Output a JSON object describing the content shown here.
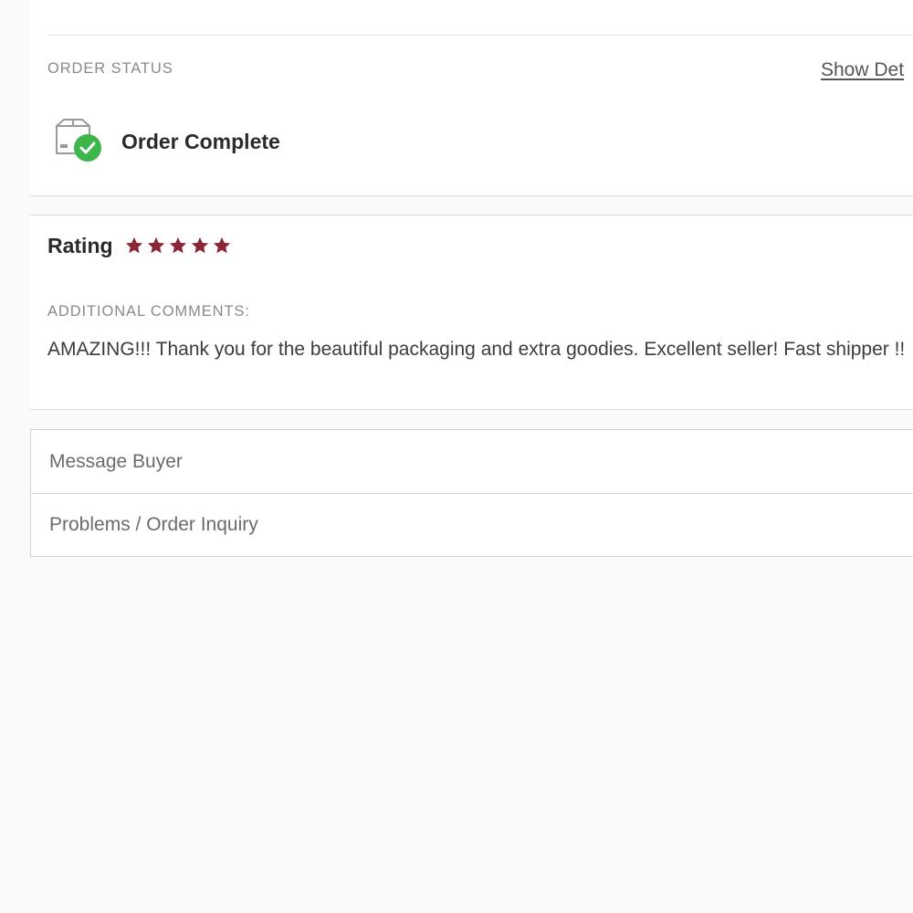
{
  "order_status": {
    "section_label": "ORDER STATUS",
    "show_details_label": "Show Det",
    "status_icon": "box-check-icon",
    "status_text": "Order Complete",
    "status_color": "#3cb64a"
  },
  "rating": {
    "title": "Rating",
    "stars_filled": 5,
    "stars_total": 5,
    "star_color": "#8b2535",
    "comments_label": "ADDITIONAL COMMENTS:",
    "comment_text": "AMAZING!!! Thank you for the beautiful packaging and extra goodies. Excellent seller! Fast shipper !!"
  },
  "actions": [
    {
      "label": "Message Buyer"
    },
    {
      "label": "Problems / Order Inquiry"
    }
  ]
}
